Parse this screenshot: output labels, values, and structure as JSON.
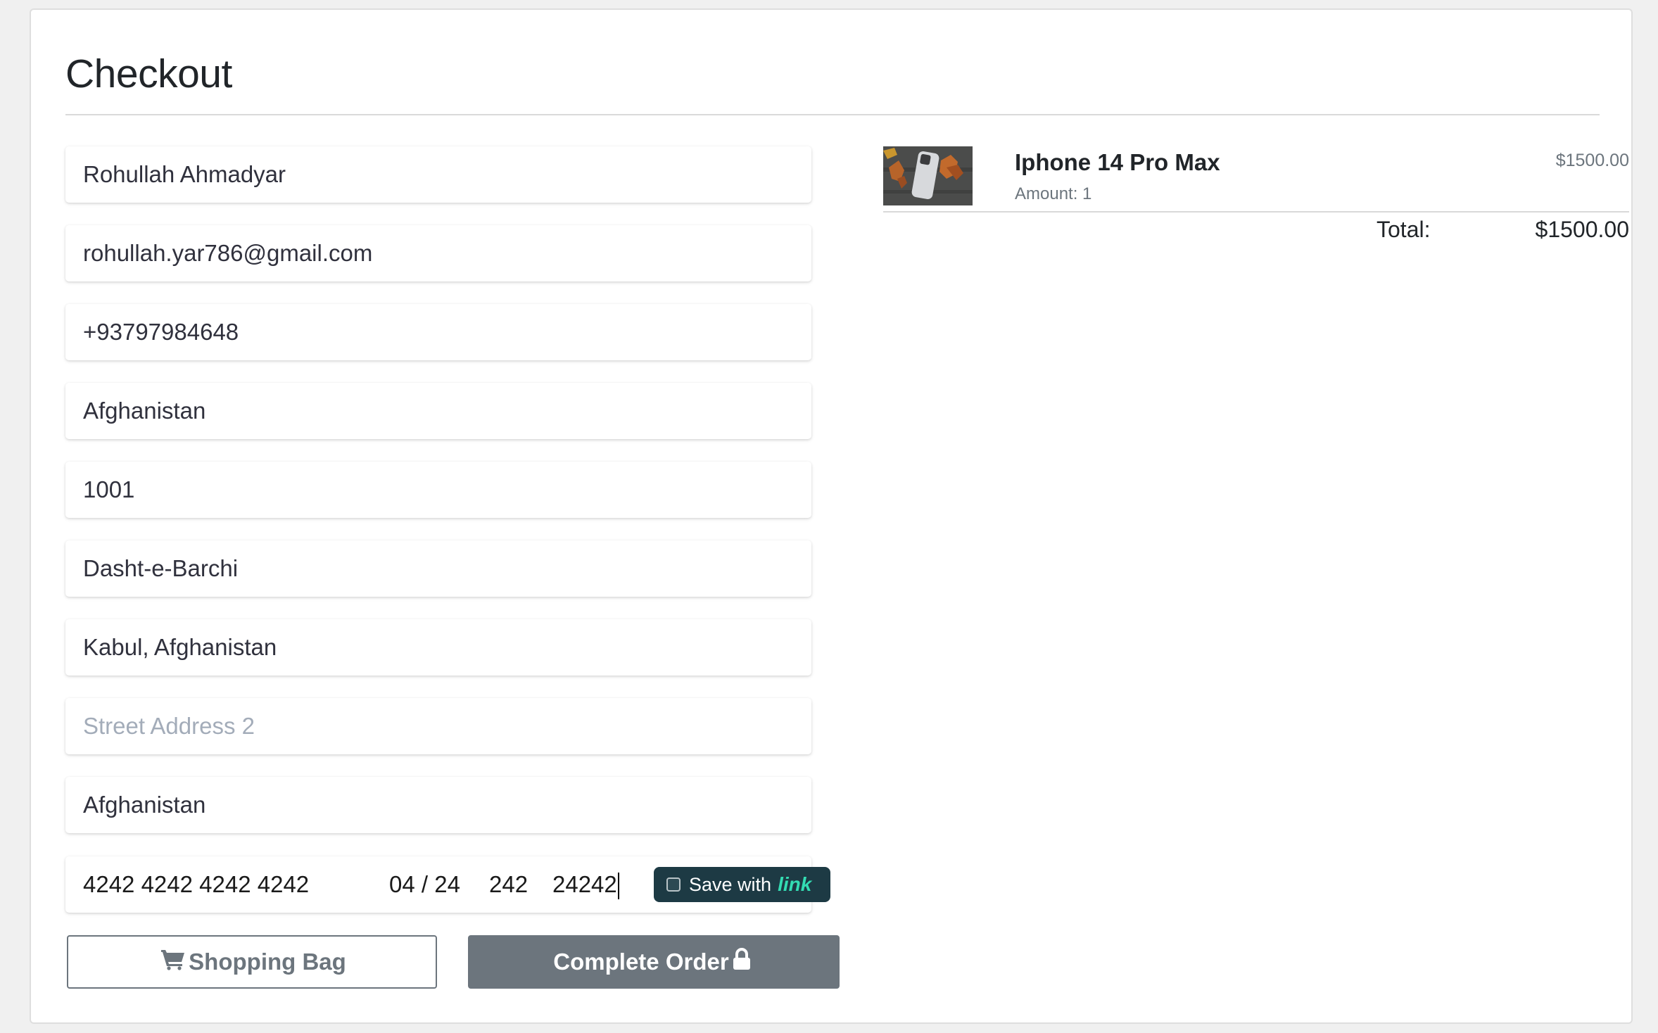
{
  "page": {
    "title": "Checkout"
  },
  "form": {
    "fields": [
      {
        "name": "full-name-field",
        "value": "Rohullah Ahmadyar",
        "placeholder": ""
      },
      {
        "name": "email-field",
        "value": "rohullah.yar786@gmail.com",
        "placeholder": ""
      },
      {
        "name": "phone-field",
        "value": "+93797984648",
        "placeholder": ""
      },
      {
        "name": "country-field",
        "value": "Afghanistan",
        "placeholder": ""
      },
      {
        "name": "postal-code-field",
        "value": "1001",
        "placeholder": ""
      },
      {
        "name": "street-address-field",
        "value": "Dasht-e-Barchi",
        "placeholder": ""
      },
      {
        "name": "city-field",
        "value": "Kabul, Afghanistan",
        "placeholder": ""
      },
      {
        "name": "street-address-2-field",
        "value": "",
        "placeholder": "Street Address 2"
      },
      {
        "name": "state-field",
        "value": "Afghanistan",
        "placeholder": ""
      }
    ],
    "card": {
      "number": "4242 4242 4242 4242",
      "expiry": "04 / 24",
      "cvc": "242",
      "zip": "24242",
      "save_label": "Save with",
      "save_brand": "link",
      "save_checked": false
    },
    "buttons": {
      "shopping_bag": "Shopping Bag",
      "complete_order": "Complete Order"
    }
  },
  "summary": {
    "item": {
      "name": "Iphone 14 Pro Max",
      "amount_label": "Amount: 1",
      "price": "$1500.00",
      "thumbnail_icon": "phone-photo"
    },
    "total_label": "Total:",
    "total_value": "$1500.00"
  },
  "colors": {
    "secondary": "#6c757d",
    "link_bg": "#1d3a44",
    "link_brand": "#33ddb3"
  }
}
